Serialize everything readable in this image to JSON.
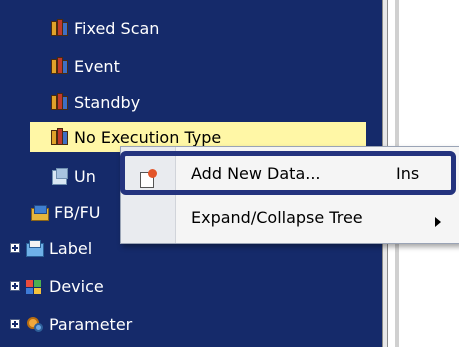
{
  "tree": {
    "items": [
      {
        "label": "Fixed Scan",
        "icon": "program-books-icon"
      },
      {
        "label": "Event",
        "icon": "program-books-icon"
      },
      {
        "label": "Standby",
        "icon": "program-books-icon"
      },
      {
        "label": "No Execution Type",
        "icon": "program-books-icon",
        "selected": true
      },
      {
        "label": "Un",
        "icon": "unregistered-program-icon"
      },
      {
        "label": "FB/FU",
        "icon": "fb-folder-icon"
      },
      {
        "label": "Label",
        "icon": "label-folder-icon",
        "expandable": true
      },
      {
        "label": "Device",
        "icon": "device-icon",
        "expandable": true
      },
      {
        "label": "Parameter",
        "icon": "parameter-icon",
        "expandable": true
      }
    ]
  },
  "context_menu": {
    "items": [
      {
        "label": "Add New Data...",
        "shortcut": "Ins",
        "icon": "add-new-data-icon",
        "highlighted": true
      },
      {
        "label": "Expand/Collapse Tree",
        "has_submenu": true
      }
    ]
  },
  "colors": {
    "tree_background": "#152a6a",
    "selected_row": "#fff7a6",
    "highlight_border": "#24337e",
    "menu_background": "#f5f5f5"
  }
}
